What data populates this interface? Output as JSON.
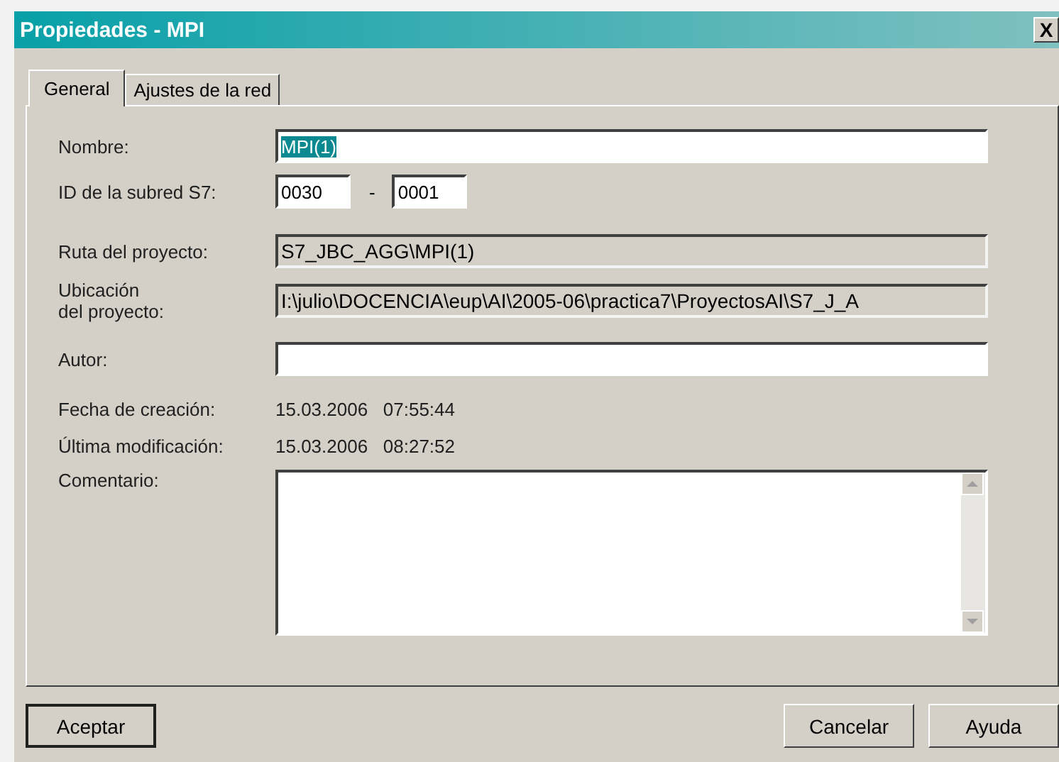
{
  "window": {
    "title": "Propiedades - MPI",
    "close": "X"
  },
  "tabs": [
    {
      "label": "General",
      "selected": true
    },
    {
      "label": "Ajustes de la red",
      "selected": false
    }
  ],
  "fields": [
    {
      "kind": "text",
      "label": "Nombre:",
      "value": "MPI(1)",
      "text_selected": true
    },
    {
      "kind": "pair",
      "label": "ID de la subred S7:",
      "value": "0030",
      "separator": "-",
      "value_2": "0001"
    },
    {
      "kind": "readonly",
      "label": "Ruta del proyecto:",
      "value": "S7_JBC_AGG\\MPI(1)"
    },
    {
      "kind": "readonly",
      "label": "Ubicación\ndel proyecto:",
      "value": "I:\\julio\\DOCENCIA\\eup\\AI\\2005-06\\practica7\\ProyectosAI\\S7_J_A"
    },
    {
      "kind": "text",
      "label": "Autor:"
    },
    {
      "kind": "info",
      "label": "Fecha de creación:",
      "value": "15.03.2006   07:55:44"
    },
    {
      "kind": "info",
      "label": "Última modificación:",
      "value": "15.03.2006   08:27:52"
    },
    {
      "kind": "memo",
      "label": "Comentario:"
    }
  ],
  "buttons": [
    {
      "label": "Aceptar",
      "default": true
    },
    {
      "label": "Cancelar",
      "default": false
    },
    {
      "label": "Ayuda",
      "default": false
    }
  ]
}
